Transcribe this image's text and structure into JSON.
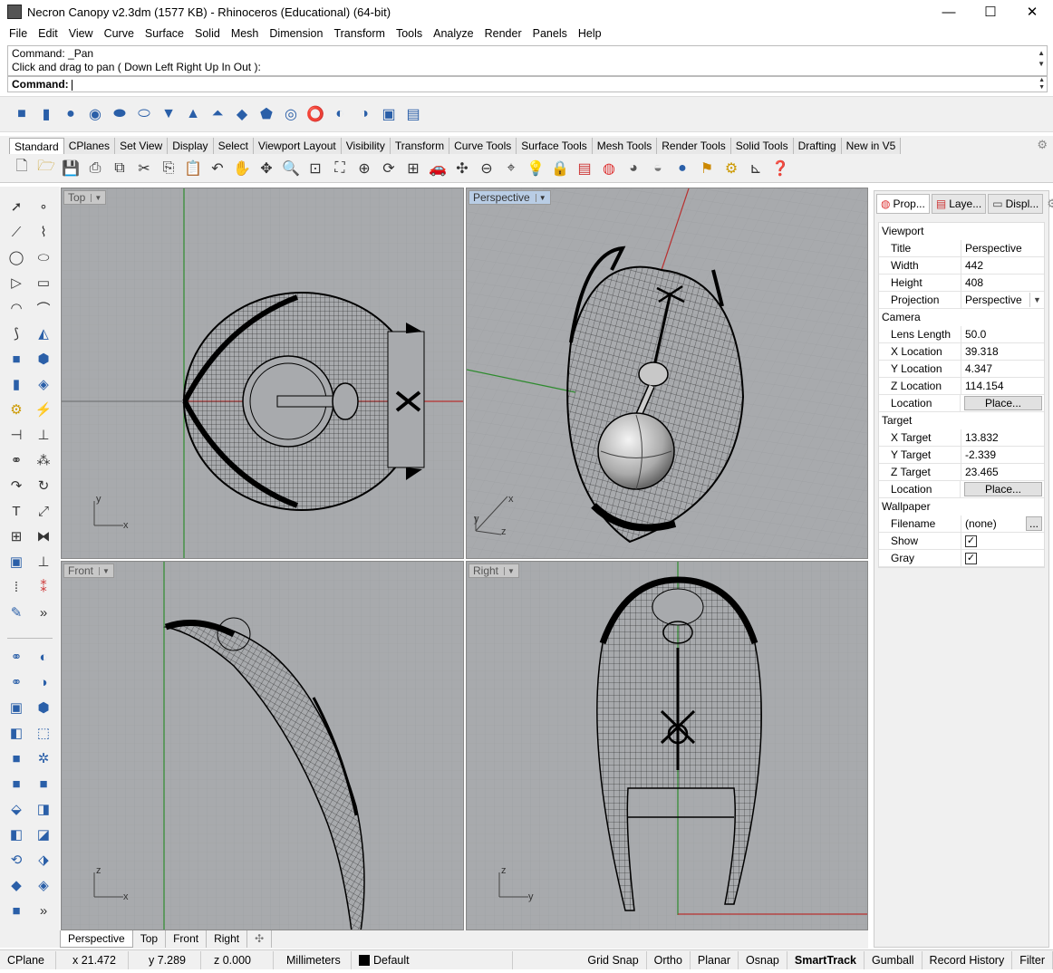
{
  "window": {
    "title": "Necron Canopy v2.3dm (1577 KB) - Rhinoceros (Educational) (64-bit)",
    "minimize": "—",
    "maximize": "☐",
    "close": "✕"
  },
  "menu": [
    "File",
    "Edit",
    "View",
    "Curve",
    "Surface",
    "Solid",
    "Mesh",
    "Dimension",
    "Transform",
    "Tools",
    "Analyze",
    "Render",
    "Panels",
    "Help"
  ],
  "command": {
    "history_line1": "Command: _Pan",
    "history_line2": "Click and drag to pan ( Down  Left  Right  Up  In  Out ):",
    "prompt": "Command:"
  },
  "toolbar_tabs": [
    "Standard",
    "CPlanes",
    "Set View",
    "Display",
    "Select",
    "Viewport Layout",
    "Visibility",
    "Transform",
    "Curve Tools",
    "Surface Tools",
    "Mesh Tools",
    "Render Tools",
    "Solid Tools",
    "Drafting",
    "New in V5"
  ],
  "viewports": {
    "top": {
      "label": "Top"
    },
    "perspective": {
      "label": "Perspective"
    },
    "front": {
      "label": "Front"
    },
    "right": {
      "label": "Right"
    }
  },
  "axis_labels": {
    "top_y": "y",
    "top_x": "x",
    "persp_x": "x",
    "persp_y": "y",
    "persp_z": "z",
    "front_z": "z",
    "front_x": "x",
    "right_z": "z",
    "right_y": "y"
  },
  "viewport_tabs": [
    "Perspective",
    "Top",
    "Front",
    "Right"
  ],
  "panel": {
    "tabs": [
      "Prop...",
      "Laye...",
      "Displ..."
    ],
    "viewport_section": "Viewport",
    "title_label": "Title",
    "title_value": "Perspective",
    "width_label": "Width",
    "width_value": "442",
    "height_label": "Height",
    "height_value": "408",
    "projection_label": "Projection",
    "projection_value": "Perspective",
    "camera_section": "Camera",
    "lens_label": "Lens Length",
    "lens_value": "50.0",
    "xloc_label": "X Location",
    "xloc_value": "39.318",
    "yloc_label": "Y Location",
    "yloc_value": "4.347",
    "zloc_label": "Z Location",
    "zloc_value": "114.154",
    "cam_location_label": "Location",
    "place_button": "Place...",
    "target_section": "Target",
    "xt_label": "X Target",
    "xt_value": "13.832",
    "yt_label": "Y Target",
    "yt_value": "-2.339",
    "zt_label": "Z Target",
    "zt_value": "23.465",
    "tgt_location_label": "Location",
    "wallpaper_section": "Wallpaper",
    "filename_label": "Filename",
    "filename_value": "(none)",
    "browse_button": "...",
    "show_label": "Show",
    "gray_label": "Gray",
    "show_checked": true,
    "gray_checked": true
  },
  "status": {
    "cplane": "CPlane",
    "x": "x 21.472",
    "y": "y 7.289",
    "z": "z 0.000",
    "units": "Millimeters",
    "layer": "Default",
    "grid_snap": "Grid Snap",
    "ortho": "Ortho",
    "planar": "Planar",
    "osnap": "Osnap",
    "smarttrack": "SmartTrack",
    "gumball": "Gumball",
    "record_history": "Record History",
    "filter": "Filter"
  },
  "icons": {
    "check": "✓",
    "more": "»",
    "add_tab": "✣"
  },
  "colors": {
    "viewport_bg": "#a8aaad",
    "grid": "#9a9c9f",
    "axis_x": "#b83030",
    "axis_y": "#2e8b2e",
    "active_label": "#b9cde5"
  }
}
